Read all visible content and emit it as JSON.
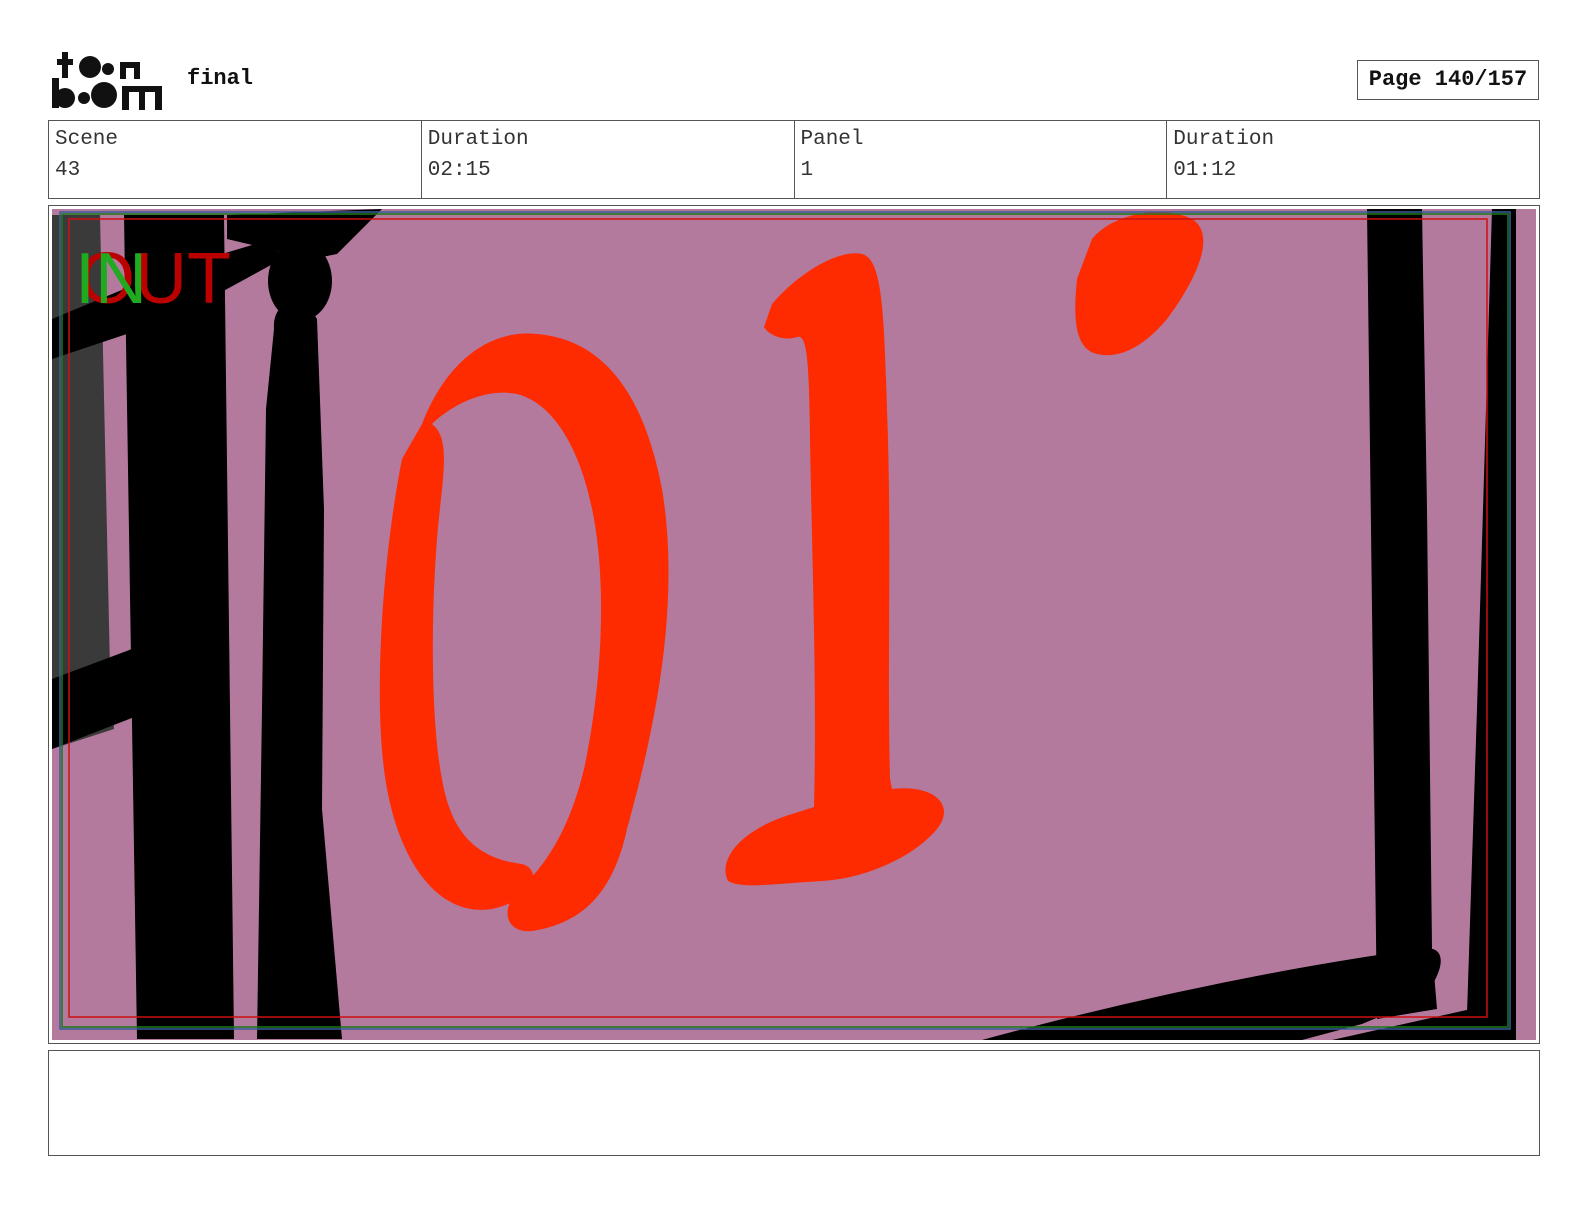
{
  "header": {
    "logo_text": "toonboom",
    "project_name": "final",
    "page_label": "Page 140/157"
  },
  "info": {
    "scene_label": "Scene",
    "scene_value": "43",
    "scene_duration_label": "Duration",
    "scene_duration_value": "02:15",
    "panel_label": "Panel",
    "panel_value": "1",
    "panel_duration_label": "Duration",
    "panel_duration_value": "01:12"
  },
  "panel": {
    "in_marker": "IN",
    "out_marker": "OUT",
    "drawn_text": "01",
    "colors": {
      "background": "#b47a9e",
      "ink": "#000000",
      "drawn_digits": "#ff2b00",
      "in_marker": "#1faa1f",
      "out_marker": "#bb0000"
    }
  },
  "notes": {
    "text": ""
  }
}
